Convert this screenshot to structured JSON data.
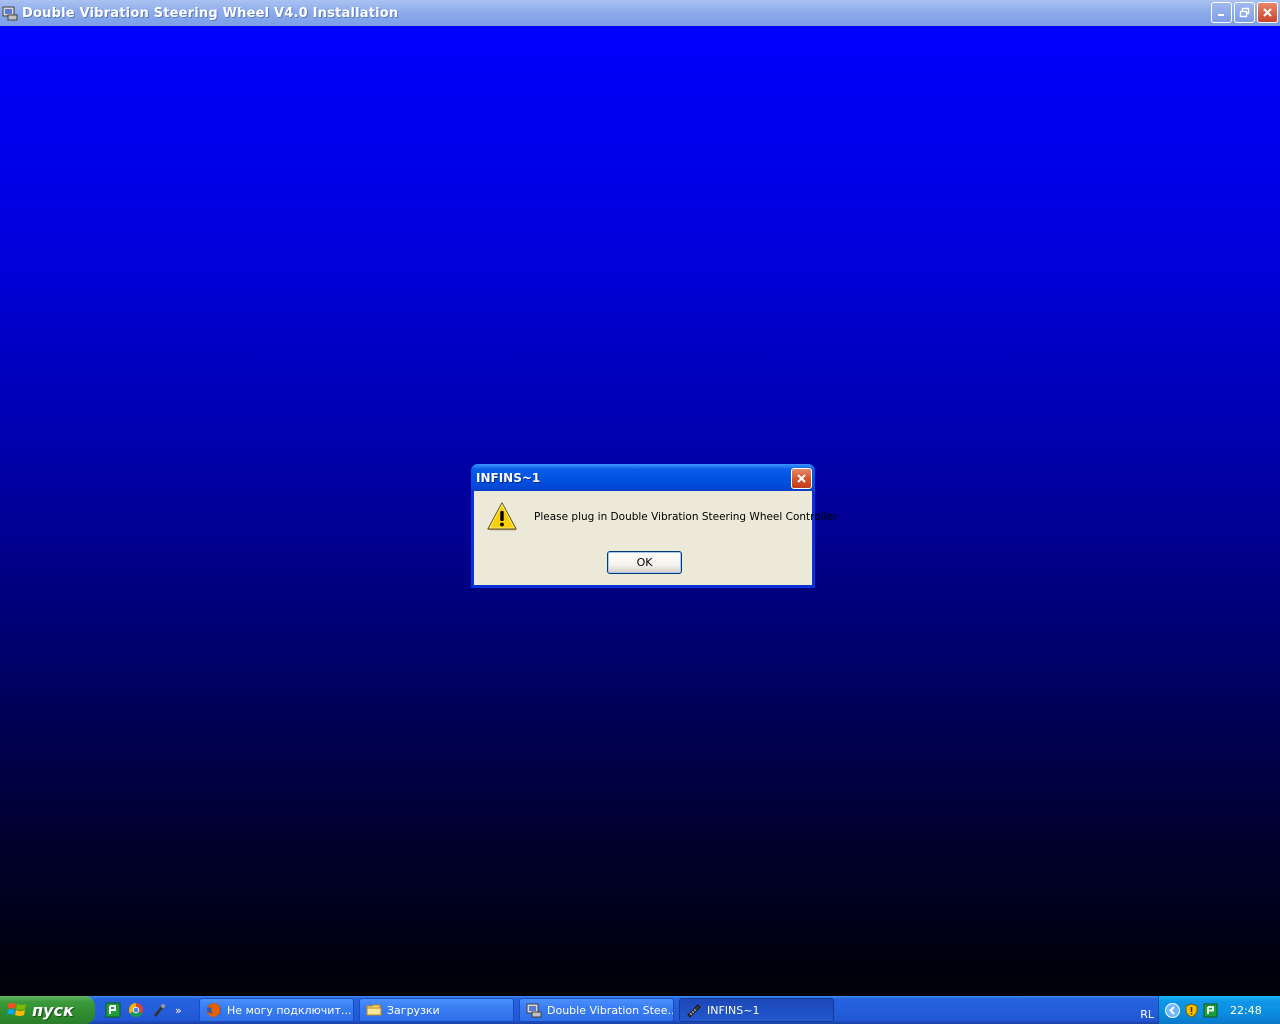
{
  "window": {
    "title": "Double Vibration Steering Wheel V4.0 Installation",
    "icon": "installer-icon",
    "controls": [
      "minimize-icon",
      "restore-icon",
      "close-icon"
    ]
  },
  "desktop": {
    "gradient": [
      "#0000ff",
      "#000008"
    ]
  },
  "dialog": {
    "title": "INFINS~1",
    "icon": "warning-icon",
    "message": "Please plug in Double Vibration Steering Wheel Controller",
    "ok_label": "OK"
  },
  "taskbar": {
    "start_label": "пуск",
    "quick_launch": [
      "guardian-icon",
      "chrome-icon",
      "pen-app-icon"
    ],
    "chevron": "»",
    "tasks": [
      {
        "label": "Не могу подключит...",
        "icon": "firefox-icon",
        "active": false
      },
      {
        "label": "Загрузки",
        "icon": "folder-icon",
        "active": false
      },
      {
        "label": "Double Vibration Stee...",
        "icon": "installer-icon",
        "active": false
      },
      {
        "label": "INFINS~1",
        "icon": "setup-icon",
        "active": true
      }
    ],
    "tray": {
      "language": "RL",
      "icons": [
        "back-arrow-icon",
        "security-shield-icon",
        "guardian-tray-icon"
      ],
      "clock": "22:48"
    }
  }
}
